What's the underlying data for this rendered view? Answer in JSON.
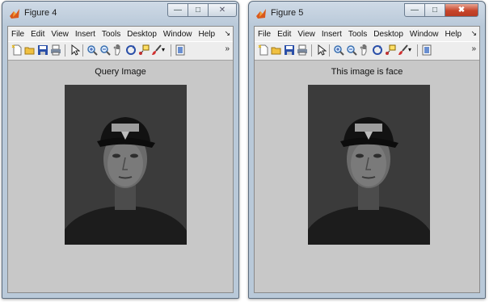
{
  "menu_items": [
    "File",
    "Edit",
    "View",
    "Insert",
    "Tools",
    "Desktop",
    "Window",
    "Help"
  ],
  "menu_more": "↘",
  "toolbar_more": "»",
  "toolbar_icons": [
    "new-file-icon",
    "open-folder-icon",
    "save-icon",
    "print-icon",
    "pointer-icon",
    "zoom-in-icon",
    "zoom-out-icon",
    "pan-hand-icon",
    "rotate-3d-icon",
    "data-cursor-icon",
    "brush-icon",
    "dropdown-arrow-icon",
    "insert-colorbar-icon"
  ],
  "left_window": {
    "title": "Figure 4",
    "figure_title": "Query Image"
  },
  "right_window": {
    "title": "Figure 5",
    "figure_title": "This image is face"
  },
  "window_controls": {
    "minimize": "—",
    "maximize": "□",
    "close_left": "✕",
    "close_right": "✖"
  },
  "colors": {
    "title_bar": "#b9c9d9",
    "client_bg": "#c8c8c8",
    "menubar_bg": "#f0f0f0",
    "close_active": "#c7452b"
  }
}
